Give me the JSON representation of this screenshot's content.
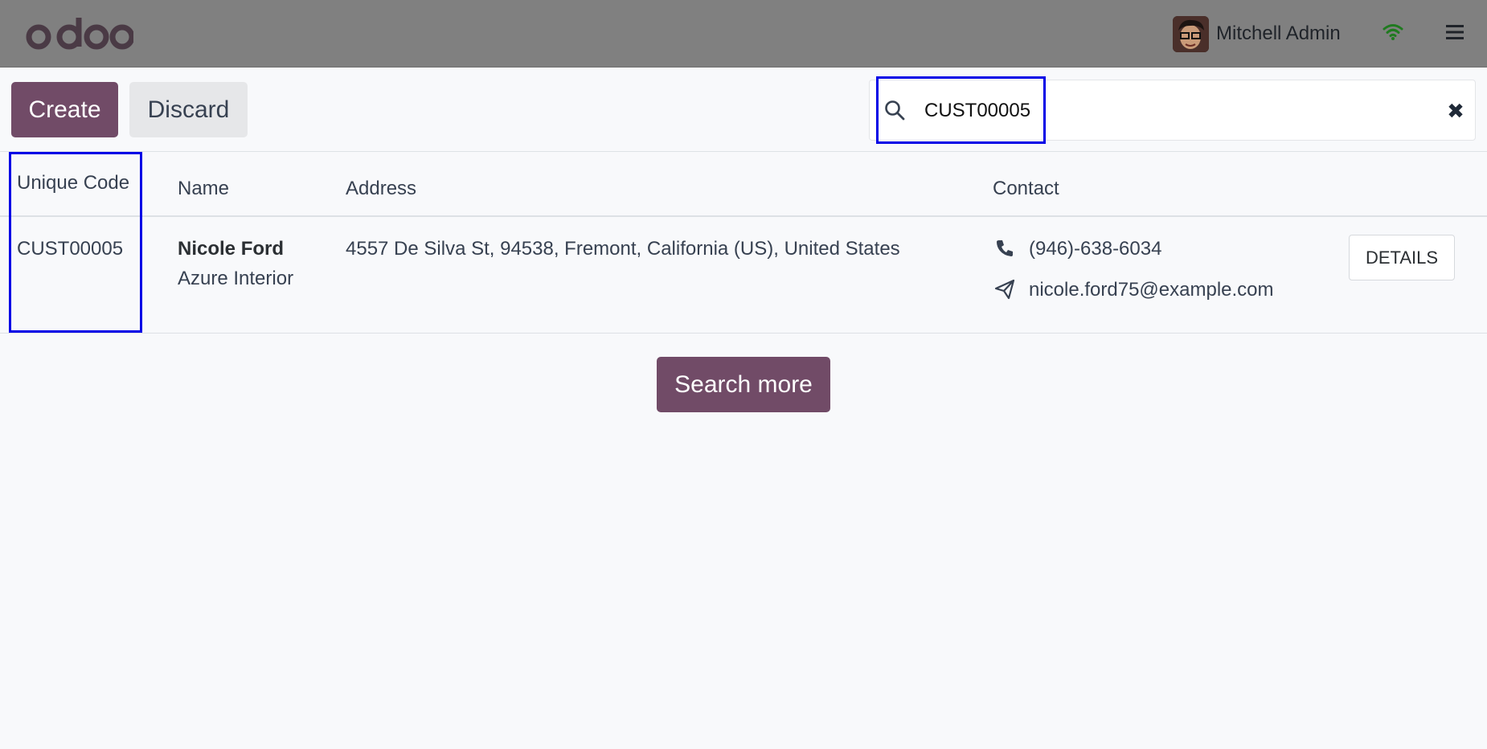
{
  "navbar": {
    "logo_text": "odoo",
    "user_name": "Mitchell Admin",
    "icons": [
      "wifi-icon",
      "menu-icon"
    ]
  },
  "toolbar": {
    "create_label": "Create",
    "discard_label": "Discard",
    "search_value": "CUST00005",
    "clear_icon": "✖"
  },
  "table": {
    "columns": [
      "Unique Code",
      "Name",
      "Address",
      "Contact"
    ],
    "rows": [
      {
        "code": "CUST00005",
        "name": "Nicole Ford",
        "company": "Azure Interior",
        "address": "4557 De Silva St, 94538, Fremont, California (US), United States",
        "phone": "(946)-638-6034",
        "email": "nicole.ford75@example.com",
        "details_label": "DETAILS"
      }
    ]
  },
  "footer": {
    "search_more_label": "Search more"
  },
  "colors": {
    "brand": "#714b67",
    "navbar": "#808080",
    "focus_outline": "#0000e6"
  }
}
